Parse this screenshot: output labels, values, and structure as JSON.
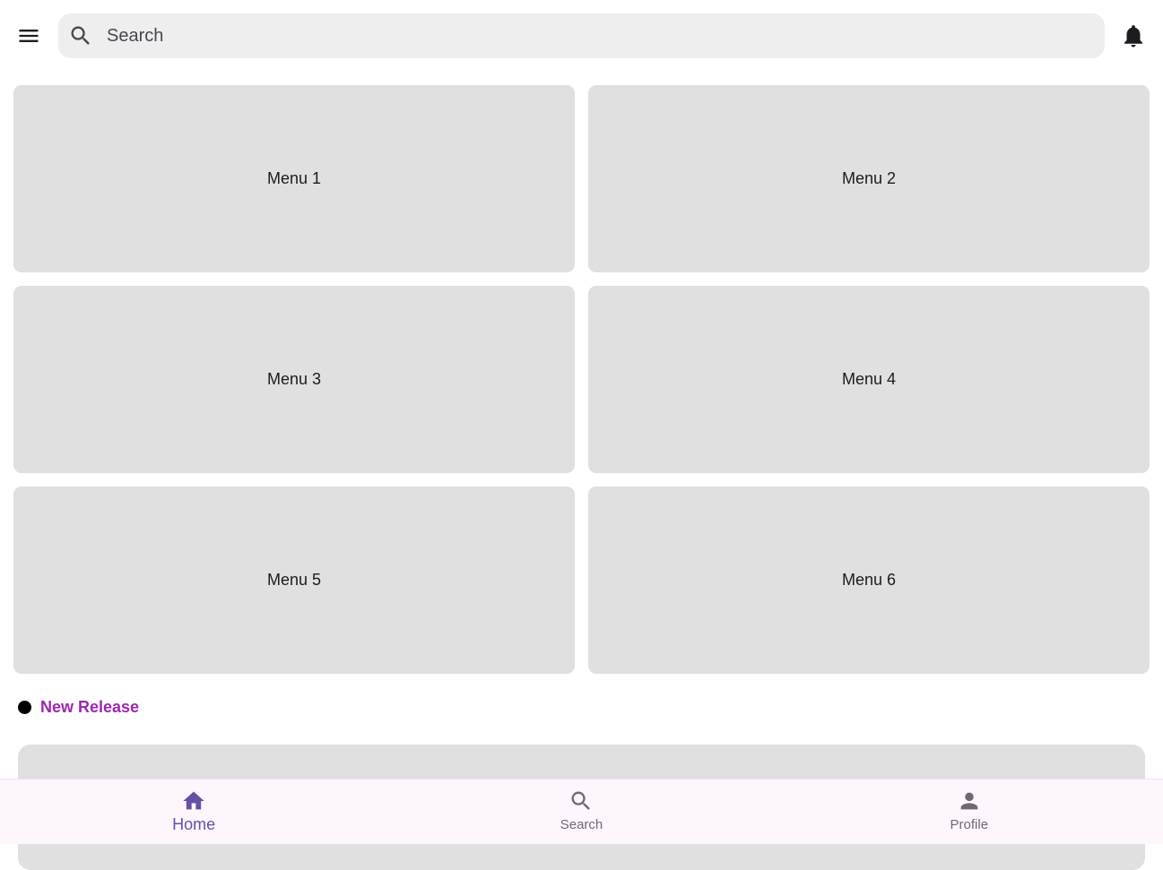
{
  "header": {
    "menu_icon": "hamburger-icon",
    "search_icon": "search-icon",
    "search_placeholder": "Search",
    "search_value": "",
    "notification_icon": "bell-icon"
  },
  "menus": [
    {
      "label": "Menu 1"
    },
    {
      "label": "Menu 2"
    },
    {
      "label": "Menu 3"
    },
    {
      "label": "Menu 4"
    },
    {
      "label": "Menu 5"
    },
    {
      "label": "Menu 6"
    }
  ],
  "new_release": {
    "title": "New Release"
  },
  "bottom_nav": {
    "items": [
      {
        "label": "Home",
        "icon": "home-icon",
        "active": true
      },
      {
        "label": "Search",
        "icon": "search-icon",
        "active": false
      },
      {
        "label": "Profile",
        "icon": "person-icon",
        "active": false
      }
    ]
  },
  "colors": {
    "card_bg": "#e0e0e0",
    "search_bg": "#eeeeee",
    "accent_purple": "#9c27b0",
    "nav_active": "#6750a4",
    "nav_inactive": "#6e6a74",
    "nav_bg": "#fdf6fd"
  }
}
